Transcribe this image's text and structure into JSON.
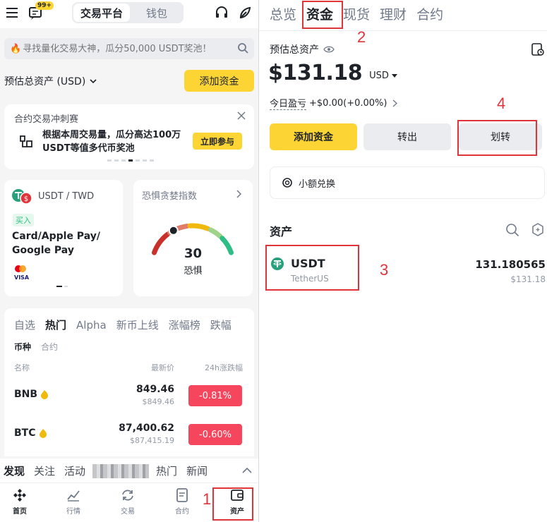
{
  "left": {
    "header": {
      "notif_badge": "99+",
      "tab_trade": "交易平台",
      "tab_wallet": "钱包"
    },
    "search": {
      "placeholder": "寻找量化交易大神，瓜分50,000 USDT奖池！"
    },
    "est_assets_label": "预估总资产 (USD)",
    "add_funds": "添加资金",
    "promo": {
      "title": "合约交易冲刺赛",
      "body": "根据本周交易量，瓜分高达100万USDT等值多代币奖池",
      "cta": "立即参与"
    },
    "buy_card": {
      "pair": "USDT / TWD",
      "tag": "买入",
      "method": "Card/Apple Pay/ Google Pay"
    },
    "fear_card": {
      "title": "恐惧贪婪指数",
      "value": "30",
      "label": "恐惧",
      "index_value": 30
    },
    "market": {
      "tabs": [
        "自选",
        "热门",
        "Alpha",
        "新币上线",
        "涨幅榜",
        "跌幅"
      ],
      "subtabs": [
        "币种",
        "合约"
      ],
      "col_name": "名称",
      "col_price": "最新价",
      "col_change": "24h涨跌幅",
      "rows": [
        {
          "symbol": "BNB",
          "price": "849.46",
          "price_usd": "$849.46",
          "change": "-0.81%"
        },
        {
          "symbol": "BTC",
          "price": "87,400.62",
          "price_usd": "$87,415.19",
          "change": "-0.60%"
        }
      ]
    },
    "feed_tabs": [
      "发现",
      "关注",
      "活动",
      "热门",
      "新闻"
    ],
    "bottom_nav": [
      "首页",
      "行情",
      "交易",
      "合约",
      "资产"
    ]
  },
  "right": {
    "tabs": [
      "总览",
      "资金",
      "现货",
      "理财",
      "合约"
    ],
    "est_label": "预估总资产",
    "total": "$131.18",
    "currency": "USD",
    "pnl_label": "今日盈亏",
    "pnl_value": "+$0.00(+0.00%)",
    "btn_add": "添加资金",
    "btn_withdraw": "转出",
    "btn_transfer": "划转",
    "small_convert": "小额兑换",
    "assets_title": "资产",
    "asset": {
      "symbol": "USDT",
      "name": "TetherUS",
      "amount": "131.180565",
      "value": "$131.18"
    }
  },
  "annotations": [
    "1",
    "2",
    "3",
    "4"
  ],
  "colors": {
    "accent": "#fcd535",
    "down": "#f6465d",
    "annotation": "#e0343b",
    "tether": "#26a17b"
  }
}
